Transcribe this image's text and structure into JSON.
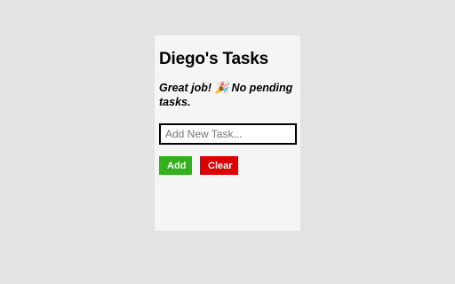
{
  "card": {
    "title": "Diego's Tasks",
    "status_message": "Great job! 🎉 No pending tasks."
  },
  "task_input": {
    "placeholder": "Add New Task...",
    "value": ""
  },
  "buttons": {
    "add_label": "Add",
    "clear_label": "Clear"
  },
  "colors": {
    "page_background": "#e3e3e3",
    "card_background": "#f5f5f5",
    "add_button": "#33b11c",
    "clear_button": "#dd0000"
  }
}
